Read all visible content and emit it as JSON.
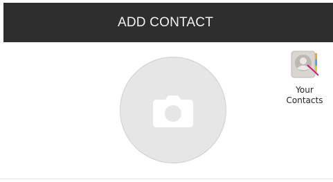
{
  "header": {
    "title": "ADD CONTACT"
  },
  "photo_picker": {
    "icon": "camera-icon"
  },
  "dock_item": {
    "icon": "contacts-app-icon",
    "label_line1": "Your",
    "label_line2": "Contacts"
  },
  "colors": {
    "header_bg": "#2e2e2e",
    "header_text": "#f2f2f2",
    "photo_circle": "#e6e6e6",
    "cursor_accent": "#d4157a"
  }
}
